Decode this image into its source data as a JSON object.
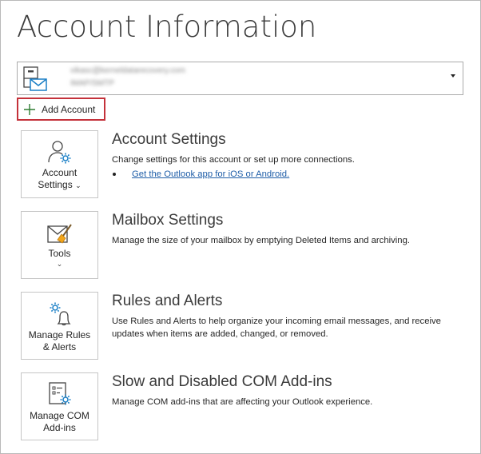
{
  "page": {
    "title": "Account Information"
  },
  "account": {
    "email": "vikasc@kerneldatarecovery.com",
    "type": "IMAP/SMTP"
  },
  "add_account": {
    "label": "Add Account"
  },
  "sections": [
    {
      "tile_line1": "Account",
      "tile_line2": "Settings",
      "title": "Account Settings",
      "description": "Change settings for this account or set up more connections.",
      "link": "Get the Outlook app for iOS or Android."
    },
    {
      "tile_line1": "Tools",
      "title": "Mailbox Settings",
      "description": "Manage the size of your mailbox by emptying Deleted Items and archiving."
    },
    {
      "tile_line1": "Manage Rules",
      "tile_line2": "& Alerts",
      "title": "Rules and Alerts",
      "description": "Use Rules and Alerts to help organize your incoming email messages, and receive updates when items are added, changed, or removed."
    },
    {
      "tile_line1": "Manage COM",
      "tile_line2": "Add-ins",
      "title": "Slow and Disabled COM Add-ins",
      "description": "Manage COM add-ins that are affecting your Outlook experience."
    }
  ],
  "colors": {
    "accent": "#1a7fc6",
    "highlight": "#c4313a",
    "link": "#1f5ea8"
  }
}
